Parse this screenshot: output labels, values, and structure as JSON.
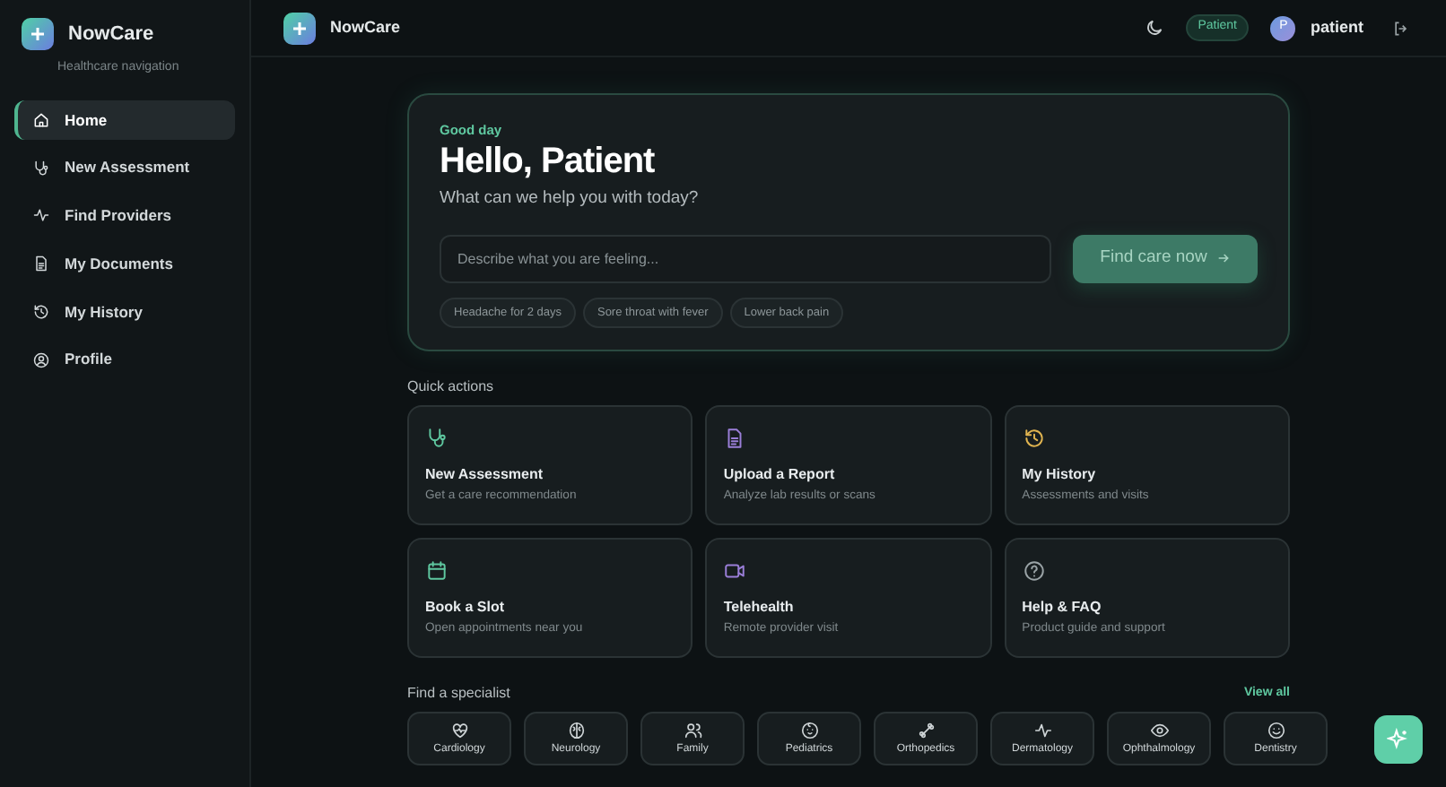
{
  "sidebar": {
    "brand": "NowCare",
    "subtitle": "Healthcare navigation",
    "items": [
      {
        "label": "Home",
        "selected": true
      },
      {
        "label": "New Assessment",
        "selected": false
      },
      {
        "label": "Find Providers",
        "selected": false
      },
      {
        "label": "My Documents",
        "selected": false
      },
      {
        "label": "My History",
        "selected": false
      },
      {
        "label": "Profile",
        "selected": false
      }
    ]
  },
  "topbar": {
    "brand": "NowCare",
    "role_badge": "Patient",
    "avatar_initial": "P",
    "username": "patient"
  },
  "hero": {
    "eyebrow": "Good day",
    "title": "Hello, Patient",
    "subtitle": "What can we help you with today?",
    "search": {
      "placeholder": "Describe what you are feeling..."
    },
    "button": "Find care now",
    "suggestions": [
      "Headache for 2 days",
      "Sore throat with fever",
      "Lower back pain"
    ]
  },
  "quick_actions": {
    "title": "Quick actions",
    "items": [
      {
        "title": "New Assessment",
        "subtitle": "Get a care recommendation",
        "color": "#5fc8a0"
      },
      {
        "title": "Upload a Report",
        "subtitle": "Analyze lab results or scans",
        "color": "#9b7fd9"
      },
      {
        "title": "My History",
        "subtitle": "Assessments and visits",
        "color": "#e0b450"
      },
      {
        "title": "Book a Slot",
        "subtitle": "Open appointments near you",
        "color": "#5fc8a0"
      },
      {
        "title": "Telehealth",
        "subtitle": "Remote provider visit",
        "color": "#9b7fd9"
      },
      {
        "title": "Help & FAQ",
        "subtitle": "Product guide and support",
        "color": "#9aa3a6"
      }
    ]
  },
  "specialists": {
    "title": "Find a specialist",
    "link": "View all",
    "items": [
      {
        "label": "Cardiology"
      },
      {
        "label": "Neurology"
      },
      {
        "label": "Family"
      },
      {
        "label": "Pediatrics"
      },
      {
        "label": "Orthopedics"
      },
      {
        "label": "Dermatology"
      },
      {
        "label": "Ophthalmology"
      },
      {
        "label": "Dentistry"
      }
    ]
  }
}
